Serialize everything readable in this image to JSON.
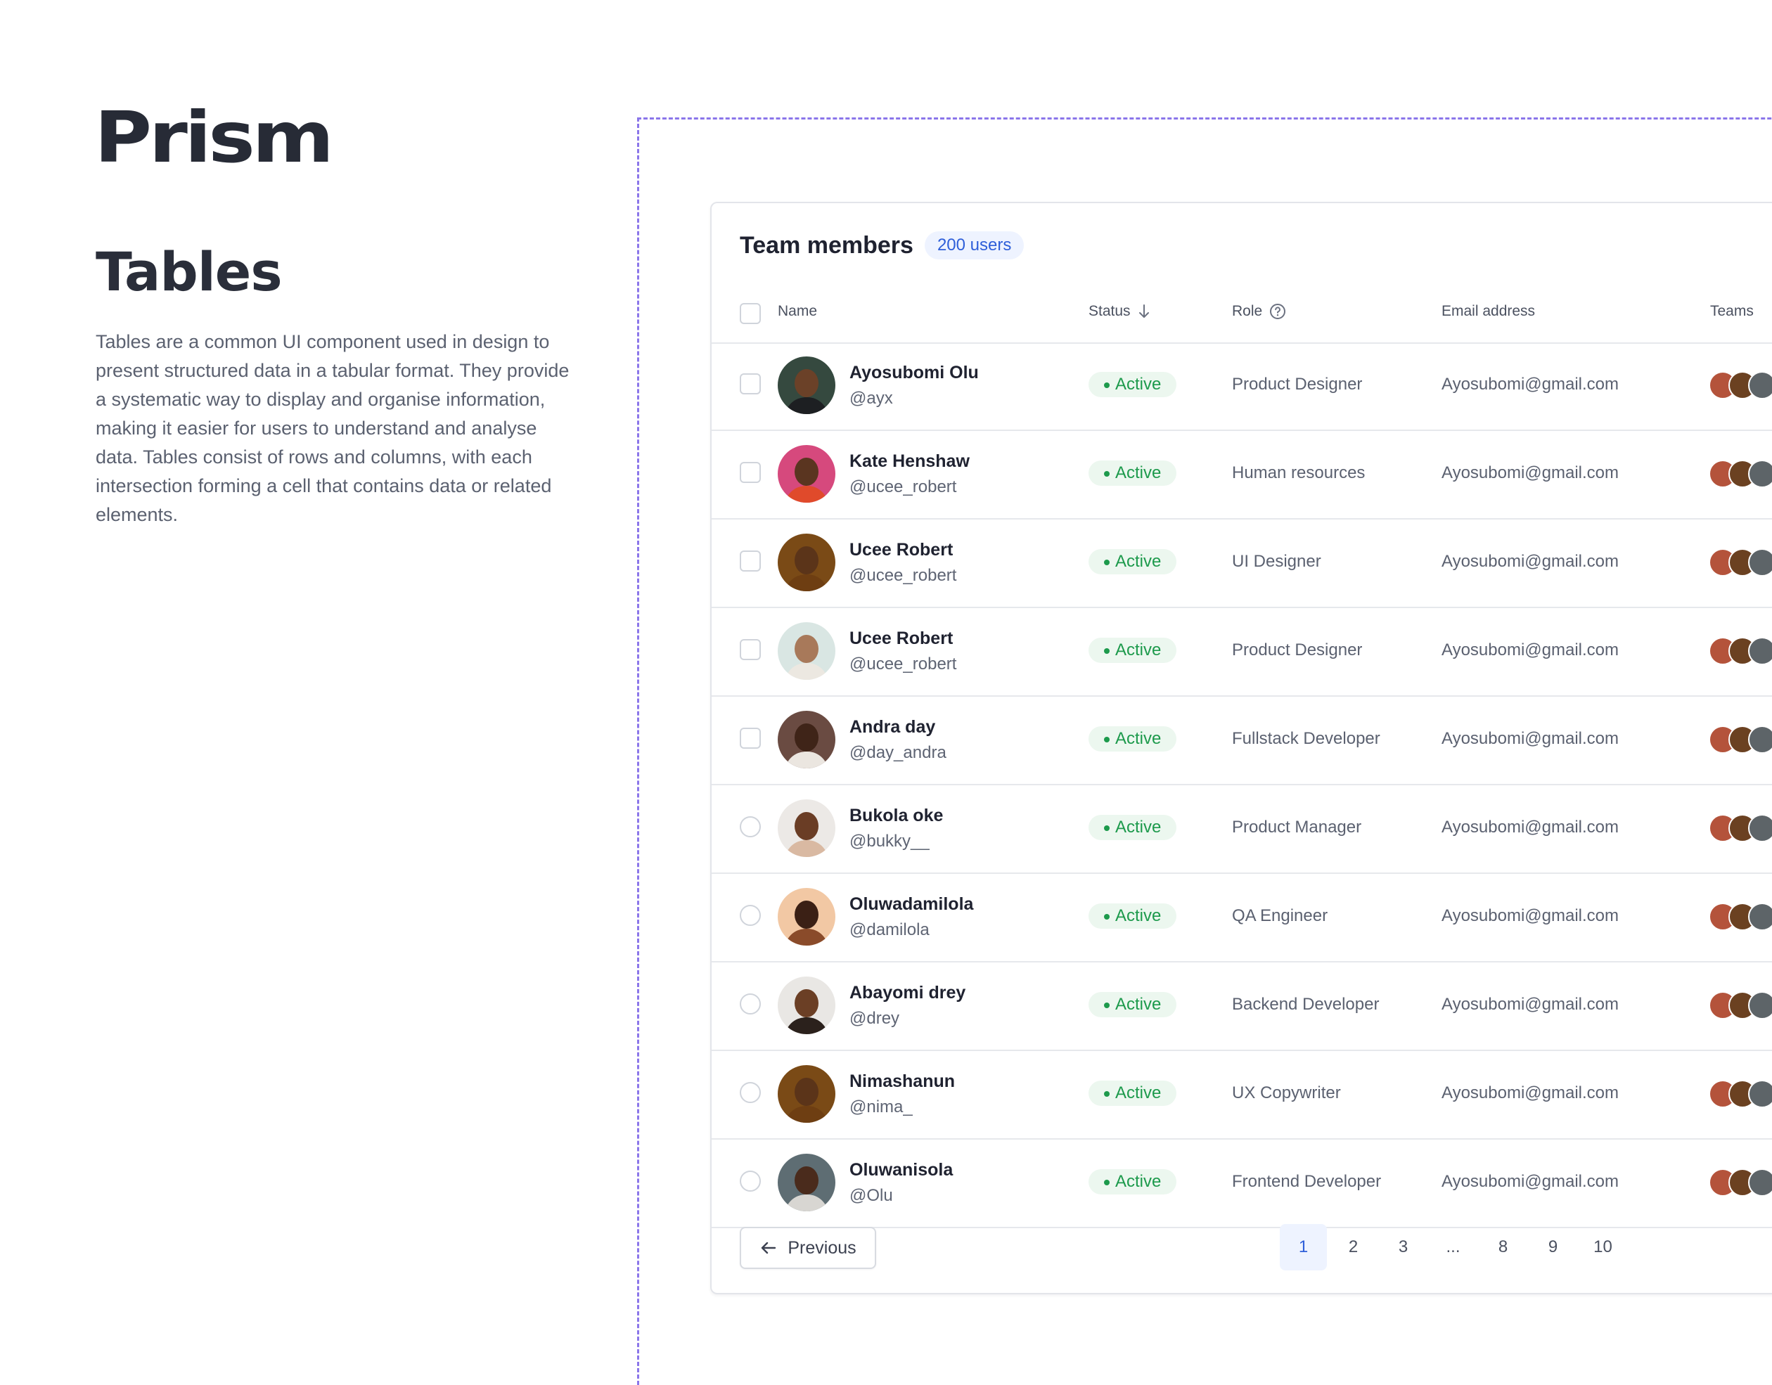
{
  "brand": {
    "logo": "Prism"
  },
  "intro": {
    "title": "Tables",
    "description": "Tables are a common UI component used in design to present structured data in a tabular format. They provide a systematic way to display and organise information, making it easier for users to understand and analyse data. Tables consist of rows and columns, with each intersection forming a cell that contains data or related elements."
  },
  "card": {
    "title": "Team members",
    "count_badge": "200 users"
  },
  "columns": {
    "name": "Name",
    "status": "Status",
    "status_sort_icon": "arrow-down-icon",
    "role": "Role",
    "role_help_icon": "help-circle-icon",
    "email": "Email address",
    "teams": "Teams"
  },
  "colors": {
    "accent": "#2f5fd9",
    "frame_dash": "#8b76ea",
    "status_active_bg": "#ecf7ef",
    "status_active_text": "#1d9a4c"
  },
  "rows": [
    {
      "name": "Ayosubomi Olu",
      "handle": "@ayx",
      "status": "Active",
      "role": "Product Designer",
      "email": "Ayosubomi@gmail.com",
      "selector": "checkbox",
      "avatar_bg": "#35493f",
      "skin": "#6b4128",
      "shirt": "#1d1f22"
    },
    {
      "name": "Kate Henshaw",
      "handle": "@ucee_robert",
      "status": "Active",
      "role": "Human resources",
      "email": "Ayosubomi@gmail.com",
      "selector": "checkbox",
      "avatar_bg": "#d6497d",
      "skin": "#5a3520",
      "shirt": "#e04a2b"
    },
    {
      "name": "Ucee Robert",
      "handle": "@ucee_robert",
      "status": "Active",
      "role": "UI Designer",
      "email": "Ayosubomi@gmail.com",
      "selector": "checkbox",
      "avatar_bg": "#7a4a16",
      "skin": "#5b3419",
      "shirt": "#6e3e12"
    },
    {
      "name": "Ucee Robert",
      "handle": "@ucee_robert",
      "status": "Active",
      "role": "Product Designer",
      "email": "Ayosubomi@gmail.com",
      "selector": "checkbox",
      "avatar_bg": "#d9e6e3",
      "skin": "#a8795a",
      "shirt": "#ece8e1"
    },
    {
      "name": "Andra day",
      "handle": "@day_andra",
      "status": "Active",
      "role": "Fullstack Developer",
      "email": "Ayosubomi@gmail.com",
      "selector": "checkbox",
      "avatar_bg": "#6a4b42",
      "skin": "#3f2418",
      "shirt": "#ebe6e0"
    },
    {
      "name": "Bukola oke",
      "handle": "@bukky__",
      "status": "Active",
      "role": "Product Manager",
      "email": "Ayosubomi@gmail.com",
      "selector": "radio",
      "avatar_bg": "#ece9e6",
      "skin": "#6a3d25",
      "shirt": "#d9b9a2"
    },
    {
      "name": "Oluwadamilola",
      "handle": "@damilola",
      "status": "Active",
      "role": "QA Engineer",
      "email": "Ayosubomi@gmail.com",
      "selector": "radio",
      "avatar_bg": "#f2c8a4",
      "skin": "#3b2015",
      "shirt": "#8a4b2a"
    },
    {
      "name": "Abayomi drey",
      "handle": "@drey",
      "status": "Active",
      "role": "Backend Developer",
      "email": "Ayosubomi@gmail.com",
      "selector": "radio",
      "avatar_bg": "#e9e7e4",
      "skin": "#6b3f25",
      "shirt": "#2b211c"
    },
    {
      "name": "Nimashanun",
      "handle": "@nima_",
      "status": "Active",
      "role": "UX Copywriter",
      "email": "Ayosubomi@gmail.com",
      "selector": "radio",
      "avatar_bg": "#7a4a16",
      "skin": "#5b3419",
      "shirt": "#6e3e12"
    },
    {
      "name": "Oluwanisola",
      "handle": "@Olu",
      "status": "Active",
      "role": "Frontend Developer",
      "email": "Ayosubomi@gmail.com",
      "selector": "radio",
      "avatar_bg": "#5e6d73",
      "skin": "#4a2b1c",
      "shirt": "#d8d6d2"
    }
  ],
  "team_avatar_colors": [
    "#b4533b",
    "#6b4121",
    "#5d6468"
  ],
  "pagination": {
    "previous_label": "Previous",
    "previous_icon": "arrow-left-icon",
    "pages": [
      "1",
      "2",
      "3",
      "...",
      "8",
      "9",
      "10"
    ],
    "current": "1"
  }
}
